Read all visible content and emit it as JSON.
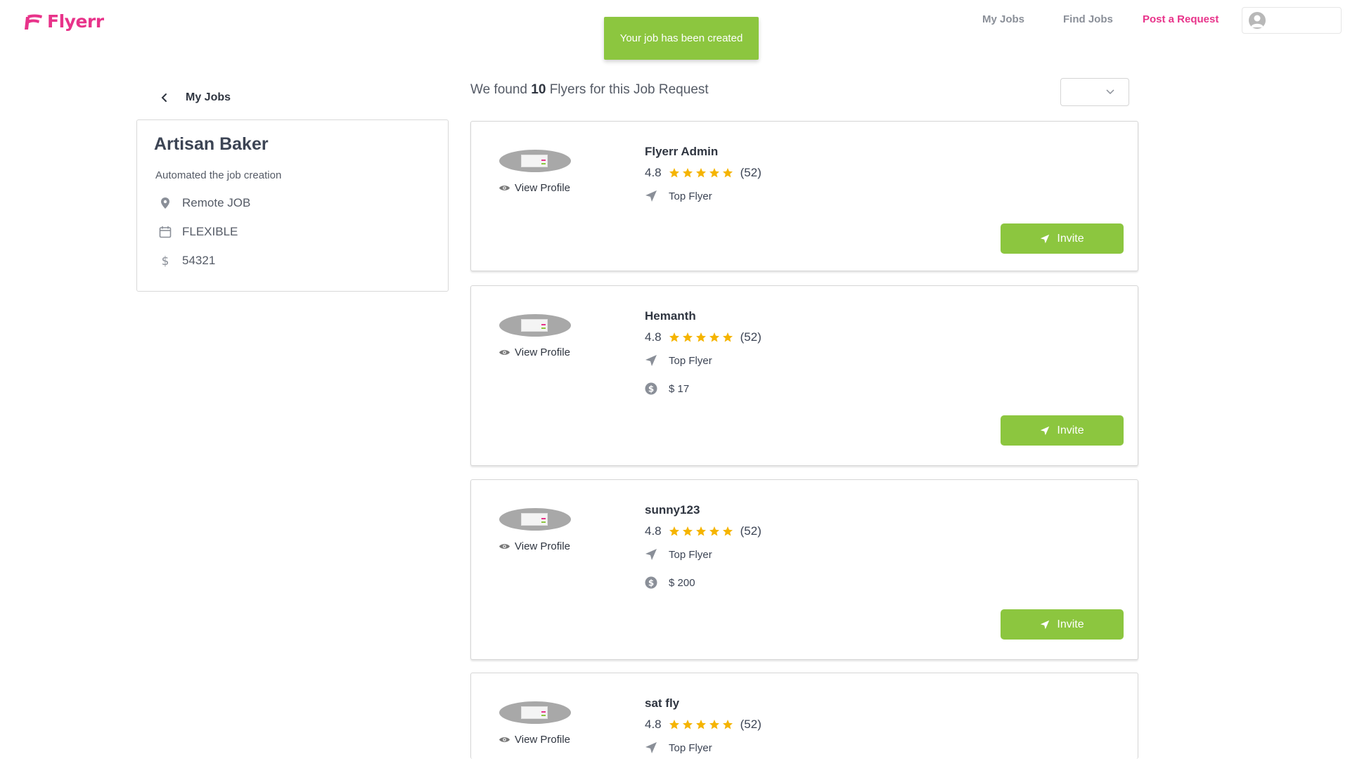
{
  "header": {
    "logo_text": "Flyerr",
    "nav": [
      {
        "label": "My Jobs"
      },
      {
        "label": "Find Jobs"
      },
      {
        "label": "Post a Request"
      }
    ],
    "accent_color": "#e8338a"
  },
  "toast": {
    "message": "Your job has been created",
    "color": "#8cc63f"
  },
  "back": {
    "label": "My Jobs"
  },
  "job": {
    "title": "Artisan Baker",
    "description": "Automated the job creation",
    "location": "Remote JOB",
    "schedule": "FLEXIBLE",
    "budget": "54321"
  },
  "results": {
    "prefix": "We found",
    "count": "10",
    "suffix": "Flyers for this Job Request",
    "sort_value": ""
  },
  "flyers": [
    {
      "name": "Flyerr Admin",
      "rating": "4.8",
      "reviews": "(52)",
      "badge": "Top Flyer",
      "rate": "",
      "view_label": "View Profile",
      "invite_label": "Invite",
      "stars": 5
    },
    {
      "name": "Hemanth",
      "rating": "4.8",
      "reviews": "(52)",
      "badge": "Top Flyer",
      "rate": "$ 17",
      "view_label": "View Profile",
      "invite_label": "Invite",
      "stars": 5
    },
    {
      "name": "sunny123",
      "rating": "4.8",
      "reviews": "(52)",
      "badge": "Top Flyer",
      "rate": "$ 200",
      "view_label": "View Profile",
      "invite_label": "Invite",
      "stars": 5
    },
    {
      "name": "sat fly",
      "rating": "4.8",
      "reviews": "(52)",
      "badge": "Top Flyer",
      "rate": "",
      "view_label": "View Profile",
      "invite_label": "Invite",
      "stars": 5
    }
  ],
  "icons": {
    "location": "map-pin-icon",
    "schedule": "calendar-icon",
    "budget": "dollar-icon",
    "badge": "paper-plane-icon",
    "rate": "dollar-circle-icon",
    "view": "eye-icon",
    "star": "star-icon"
  }
}
